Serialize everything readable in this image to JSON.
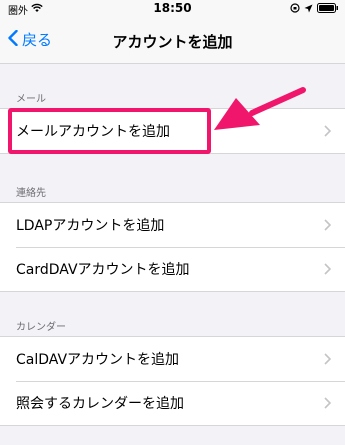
{
  "status_bar": {
    "carrier": "圏外",
    "time": "18:50"
  },
  "nav": {
    "back_label": "戻る",
    "title": "アカウントを追加"
  },
  "sections": {
    "mail": {
      "header": "メール",
      "items": [
        "メールアカウントを追加"
      ]
    },
    "contacts": {
      "header": "連絡先",
      "items": [
        "LDAPアカウントを追加",
        "CardDAVアカウントを追加"
      ]
    },
    "calendar": {
      "header": "カレンダー",
      "items": [
        "CalDAVアカウントを追加",
        "照会するカレンダーを追加"
      ]
    }
  },
  "colors": {
    "accent": "#007aff",
    "annotation": "#f0166b",
    "background": "#f2f2f7"
  }
}
